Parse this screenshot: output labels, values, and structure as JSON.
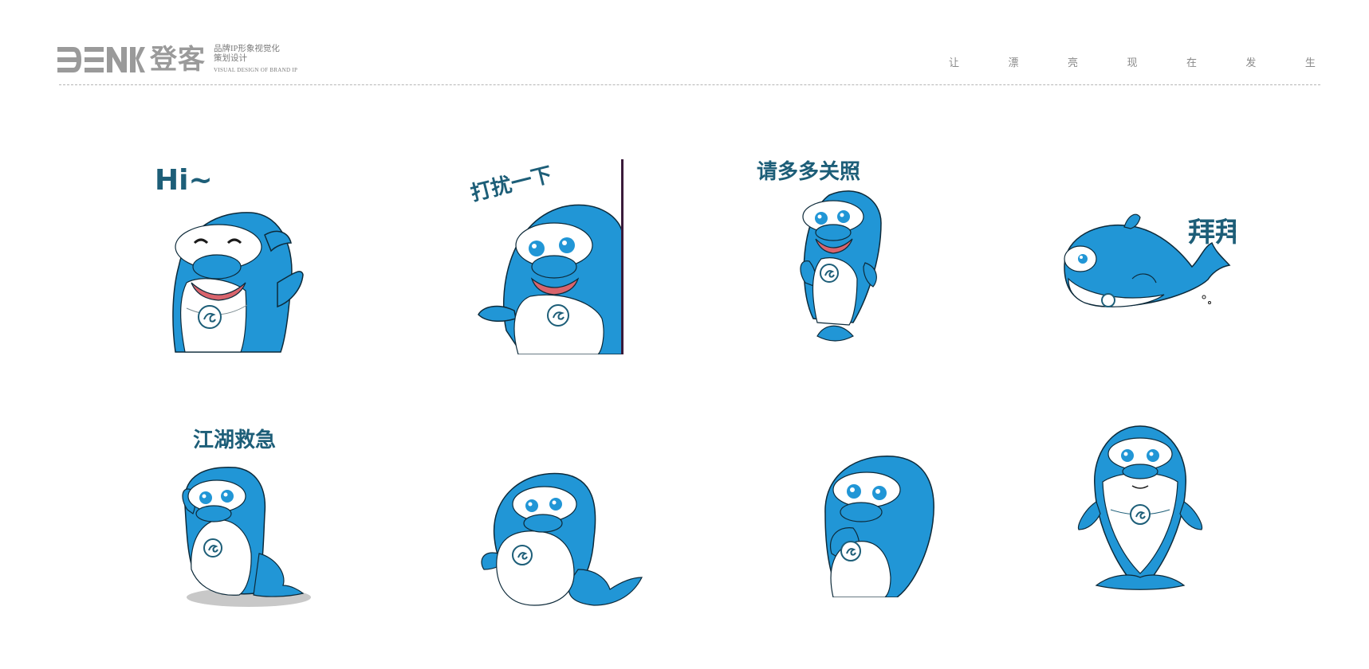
{
  "brand": {
    "logo_text": "DENK",
    "name_cn": "登客",
    "subtitle_line1": "品牌IP形象视觉化",
    "subtitle_line2": "策划设计",
    "subtitle_en": "VISUAL DESIGN OF BRAND IP"
  },
  "slogan": [
    "让",
    "漂",
    "亮",
    "现",
    "在",
    "发",
    "生"
  ],
  "colors": {
    "dolphin_blue": "#2196d6",
    "caption": "#1d5e78",
    "mouth": "#d9646c"
  },
  "stickers": [
    {
      "caption": "Hi~",
      "pose": "waving-smiling"
    },
    {
      "caption": "打扰一下",
      "pose": "peeking-from-wall"
    },
    {
      "caption": "请多多关照",
      "pose": "standing-laughing"
    },
    {
      "caption": "拜拜",
      "pose": "swimming-whale"
    },
    {
      "caption": "江湖救急",
      "pose": "sitting-tail-curled"
    },
    {
      "caption": "",
      "pose": "sitting-side"
    },
    {
      "caption": "",
      "pose": "thinking"
    },
    {
      "caption": "",
      "pose": "standing-front"
    }
  ]
}
